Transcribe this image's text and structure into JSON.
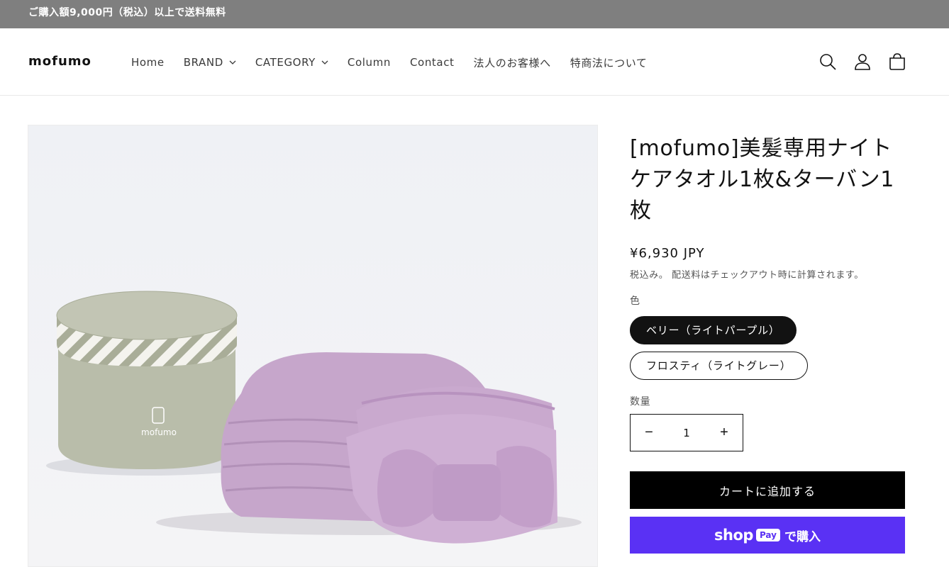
{
  "announcement": {
    "text": "ご購入額9,000円（税込）以上で送料無料"
  },
  "header": {
    "logo_text": "mofumo",
    "nav": [
      {
        "label": "Home",
        "has_dropdown": false
      },
      {
        "label": "BRAND",
        "has_dropdown": true
      },
      {
        "label": "CATEGORY",
        "has_dropdown": true
      },
      {
        "label": "Column",
        "has_dropdown": false
      },
      {
        "label": "Contact",
        "has_dropdown": false
      },
      {
        "label": "法人のお客様へ",
        "has_dropdown": false
      },
      {
        "label": "特商法について",
        "has_dropdown": false
      }
    ],
    "icons": [
      "search-icon",
      "account-icon",
      "cart-icon"
    ]
  },
  "product": {
    "image_box_brand": "mofumo",
    "title": "[mofumo]美髪専用ナイトケアタオル1枚&ターバン1枚",
    "price": "¥6,930 JPY",
    "tax_note": "税込み。 配送料はチェックアウト時に計算されます。",
    "option_label": "色",
    "variants": [
      {
        "label": "ベリー（ライトパープル）",
        "selected": true
      },
      {
        "label": "フロスティ（ライトグレー）",
        "selected": false
      }
    ],
    "quantity_label": "数量",
    "quantity": "1",
    "minus": "−",
    "plus": "+",
    "add_to_cart": "カートに追加する",
    "shoppay": {
      "shop": "shop",
      "pay": "Pay",
      "buy": "で購入"
    }
  },
  "colors": {
    "announcement_bg": "#7f7f7f",
    "shoppay": "#5a31f4",
    "towel": "#c7a7cc",
    "box": "#b9bdaa"
  }
}
